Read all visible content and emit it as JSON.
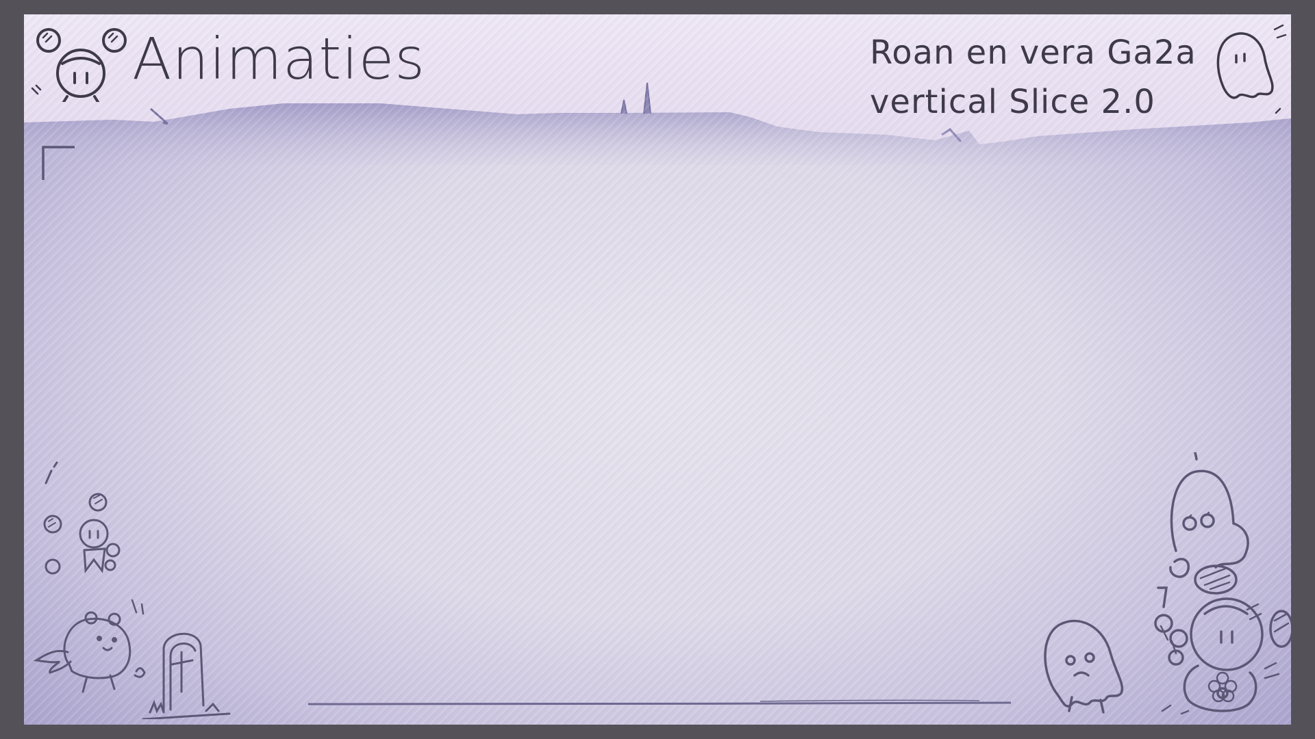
{
  "header": {
    "title": "Animaties",
    "subtitle_line1": "Roan en vera Ga2a",
    "subtitle_line2": "vertical Slice 2.0"
  },
  "colors": {
    "frame": "#555159",
    "header_paper": "#efe8f7",
    "panel_center": "#e7e4ef",
    "panel_edge": "#a7a0cc",
    "ink": "#3e3a4a"
  },
  "icons": {
    "logo": "round-character-with-ear-buns",
    "top_right": "ghost",
    "bottom_left": [
      "small-character",
      "winged-hamster",
      "tombstone-with-cross"
    ],
    "bottom_right": [
      "ghost",
      "round-character-with-flower",
      "small-ghost"
    ]
  }
}
